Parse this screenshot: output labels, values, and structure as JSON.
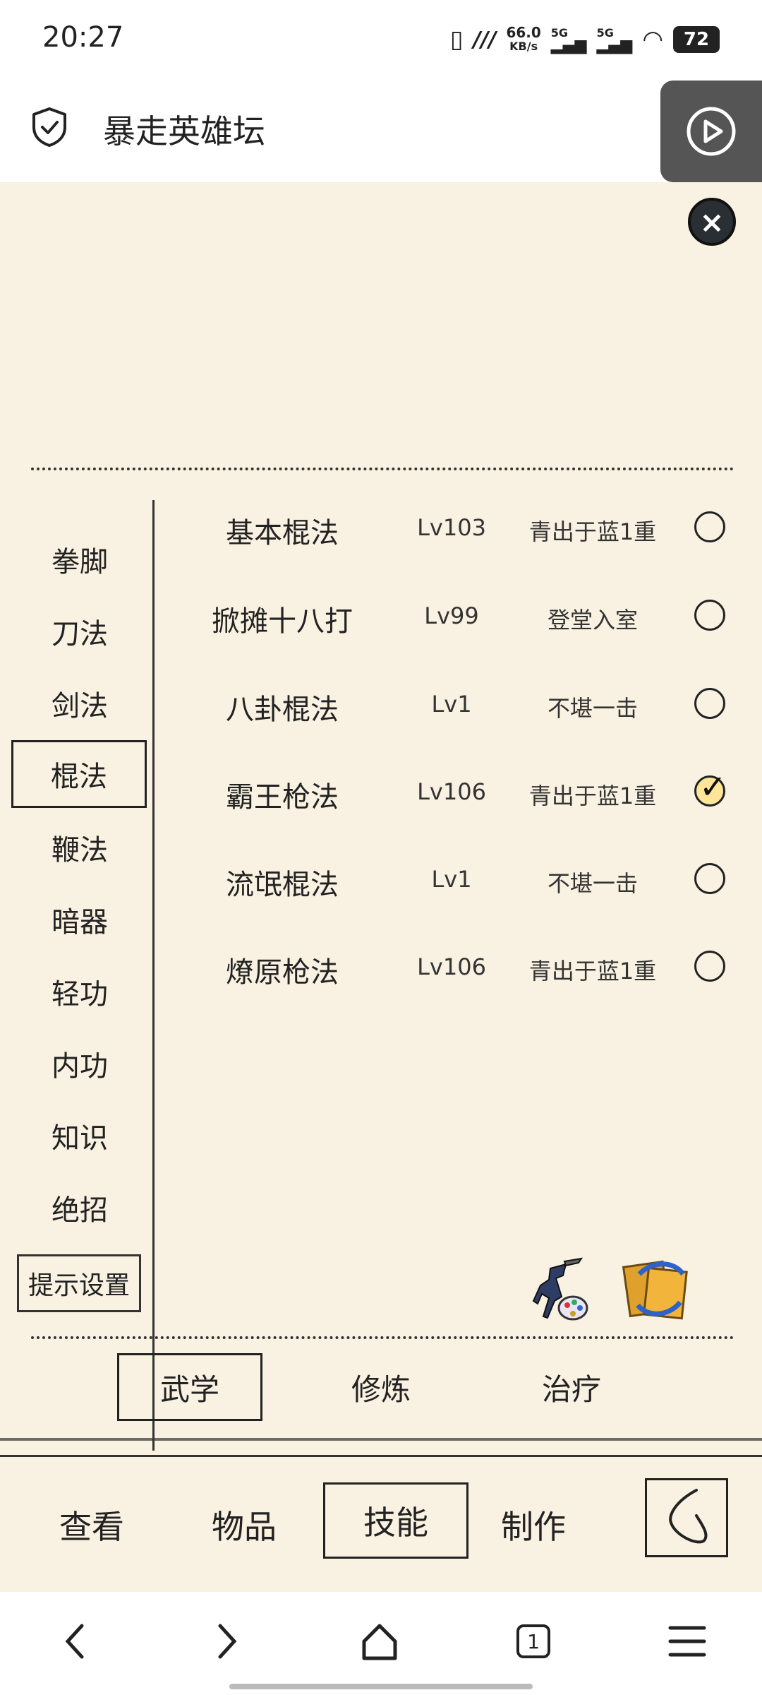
{
  "status_bar": {
    "time": "20:27",
    "net_speed_value": "66.0",
    "net_speed_unit": "KB/s",
    "sig1": "5G",
    "sig2": "5G",
    "battery": "72"
  },
  "header": {
    "title": "暴走英雄坛"
  },
  "categories": [
    {
      "label": "拳脚"
    },
    {
      "label": "刀法"
    },
    {
      "label": "剑法"
    },
    {
      "label": "棍法"
    },
    {
      "label": "鞭法"
    },
    {
      "label": "暗器"
    },
    {
      "label": "轻功"
    },
    {
      "label": "内功"
    },
    {
      "label": "知识"
    },
    {
      "label": "绝招"
    }
  ],
  "selected_category": "棍法",
  "hint_button": "提示设置",
  "skills": [
    {
      "name": "基本棍法",
      "level": "Lv103",
      "rank": "青出于蓝1重",
      "equipped": false
    },
    {
      "name": "掀摊十八打",
      "level": "Lv99",
      "rank": "登堂入室",
      "equipped": false
    },
    {
      "name": "八卦棍法",
      "level": "Lv1",
      "rank": "不堪一击",
      "equipped": false
    },
    {
      "name": "霸王枪法",
      "level": "Lv106",
      "rank": "青出于蓝1重",
      "equipped": true
    },
    {
      "name": "流氓棍法",
      "level": "Lv1",
      "rank": "不堪一击",
      "equipped": false
    },
    {
      "name": "燎原枪法",
      "level": "Lv106",
      "rank": "青出于蓝1重",
      "equipped": false
    }
  ],
  "sub_tabs": [
    {
      "label": "武学"
    },
    {
      "label": "修炼"
    },
    {
      "label": "治疗"
    }
  ],
  "bottom_nav": [
    {
      "label": "查看"
    },
    {
      "label": "物品"
    },
    {
      "label": "技能"
    },
    {
      "label": "制作"
    }
  ],
  "browser": {
    "tab_count": "1"
  }
}
